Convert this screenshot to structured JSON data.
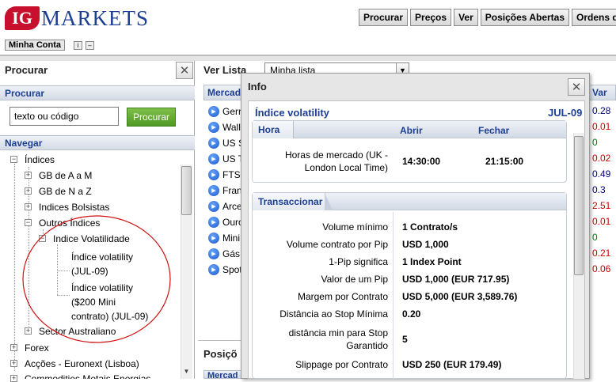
{
  "header": {
    "logo_ig": "IG",
    "logo_text": "MARKETS",
    "nav": [
      "Procurar",
      "Preços",
      "Ver",
      "Posições Abertas",
      "Ordens de"
    ]
  },
  "account": {
    "label": "Minha Conta"
  },
  "left_panel": {
    "title": "Procurar",
    "search_section": "Procurar",
    "search_value": "texto ou código",
    "search_button": "Procurar",
    "nav_section": "Navegar",
    "tree": {
      "indices": "Índices",
      "gb_a_m": "GB de A a M",
      "gb_n_z": "GB de N a Z",
      "bolsistas": "Indices Bolsistas",
      "outros": "Outros Índices",
      "volatilidade": "Indice Volatilidade",
      "vol_jul_1": "Índice volatility",
      "vol_jul_2": "(JUL-09)",
      "vol_mini_1": "Índice volatility",
      "vol_mini_2": "($200 Mini",
      "vol_mini_3": "contrato) (JUL-09)",
      "australiano": "Sector Australiano",
      "forex": "Forex",
      "accoes": "Acções - Euronext (Lisboa)",
      "commodities": "Commodities Metais Energias"
    }
  },
  "right_panel": {
    "ver_lista": "Ver Lista",
    "lista_value": "Minha lista",
    "markets_header": "Mercad",
    "markets": [
      "Gerr",
      "Wall",
      "US S",
      "US T",
      "FTSI",
      "Fran",
      "Arce",
      "Ouro",
      "Mini",
      "Gás",
      "Spot"
    ],
    "var_header": "Var",
    "var_values": [
      "0.28",
      "0.01",
      "0",
      "0.02",
      "0.49",
      "0.3",
      "2.51",
      "0.01",
      "0",
      "0.21",
      "0.06"
    ],
    "var_colors": [
      "#000080",
      "#cc0000",
      "#008000",
      "#cc0000",
      "#000080",
      "#000080",
      "#cc0000",
      "#cc0000",
      "#008000",
      "#cc0000",
      "#cc0000"
    ],
    "positions_header": "Posiçõ",
    "positions_sub": "Mercad"
  },
  "info": {
    "title": "Info",
    "instrument": "Índice volatility",
    "expiry": "JUL-09",
    "hours": {
      "tab": "Hora",
      "col_open": "Abrir",
      "col_close": "Fechar",
      "row_label_1": "Horas de mercado (UK -",
      "row_label_2": "London Local Time)",
      "open": "14:30:00",
      "close": "21:15:00"
    },
    "trading": {
      "tab": "Transaccionar",
      "rows": [
        {
          "label": "Volume mínimo",
          "value": "1 Contrato/s"
        },
        {
          "label": "Volume contrato por Pip",
          "value": "USD 1,000"
        },
        {
          "label": "1-Pip significa",
          "value": "1 Index Point"
        },
        {
          "label": "Valor de um Pip",
          "value": "USD 1,000 (EUR 717.95)"
        },
        {
          "label": "Margem por Contrato",
          "value": "USD 5,000 (EUR 3,589.76)"
        },
        {
          "label": "Distância ao Stop Mínima",
          "value": "0.20"
        },
        {
          "label": "distância min para Stop Garantido",
          "value": "5"
        },
        {
          "label": "Slippage por Contrato",
          "value": "USD 250 (EUR 179.49)"
        }
      ]
    }
  },
  "colors": {
    "brand_blue": "#1c3f94",
    "brand_red": "#c8102e",
    "search_green": "#4e9a25"
  }
}
